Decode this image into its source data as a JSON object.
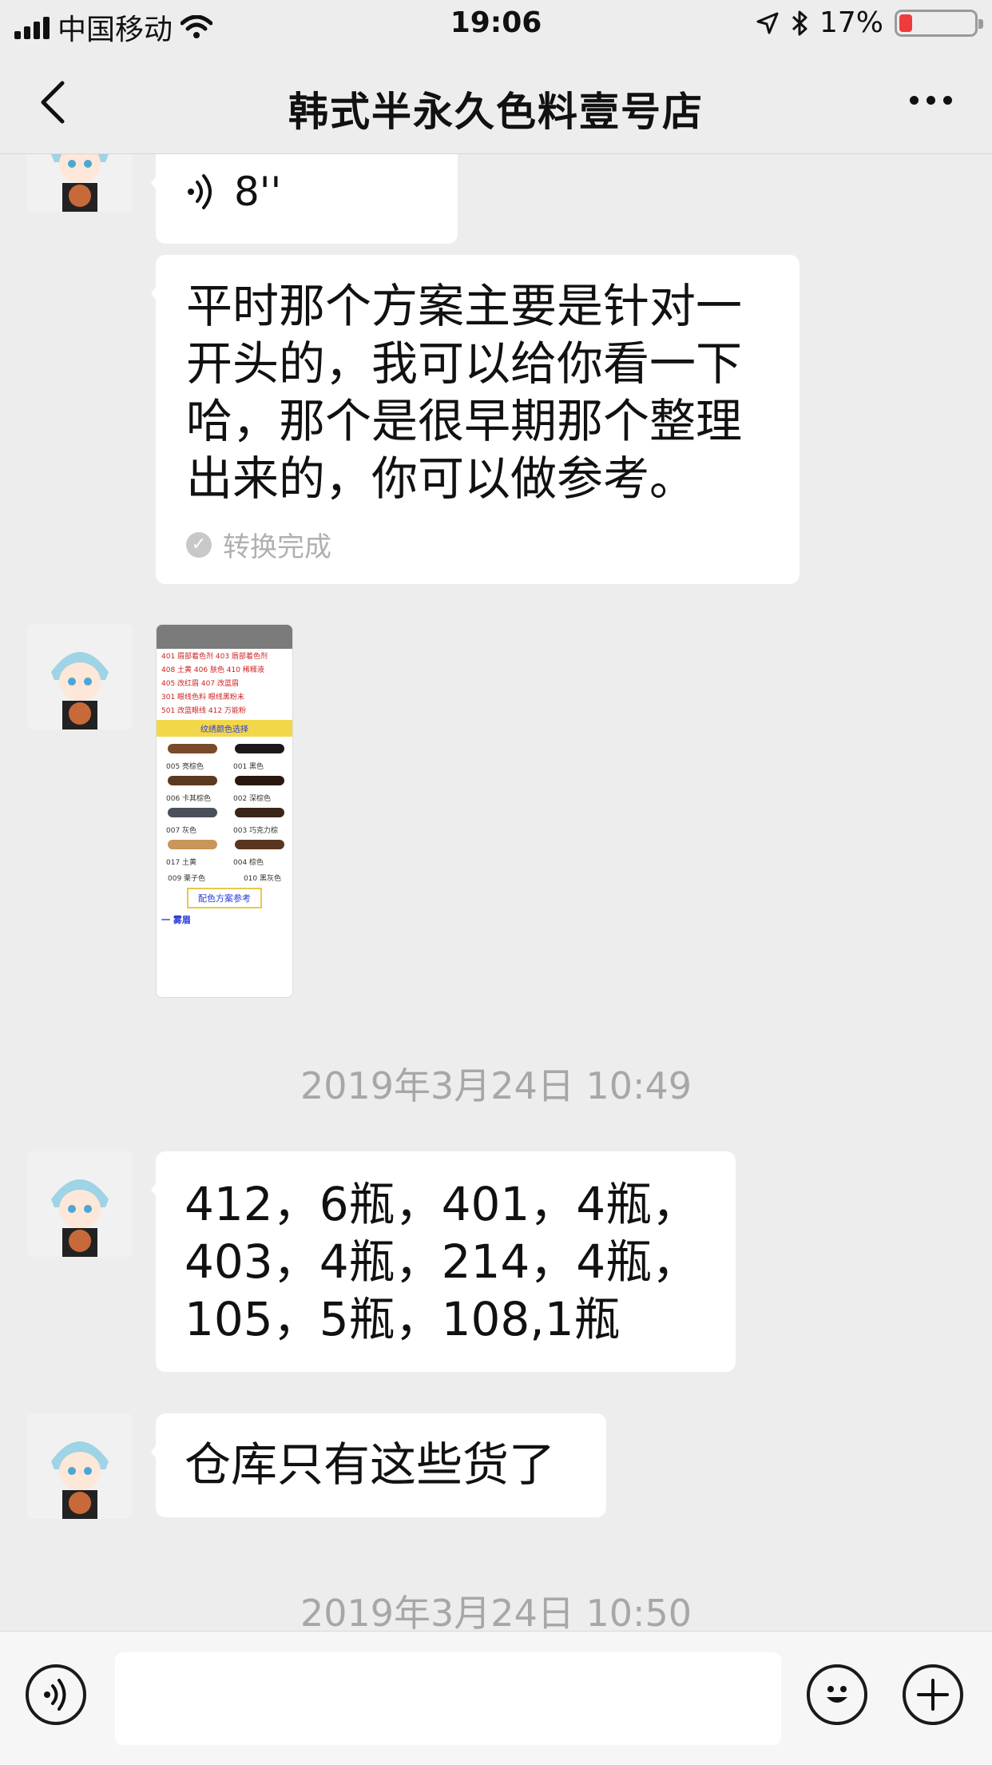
{
  "status_bar": {
    "carrier": "中国移动",
    "time": "19:06",
    "battery_percent": "17%",
    "battery_level": 0.17
  },
  "nav": {
    "title": "韩式半永久色料壹号店",
    "back_icon": "chevron-left-icon",
    "more_icon": "more-dots-icon"
  },
  "messages": [
    {
      "type": "voice",
      "duration": "8''"
    },
    {
      "type": "text",
      "text": "平时那个方案主要是针对一\n开头的，我可以给你看一下\n哈，那个是很早期那个整理\n出来的，你可以做参考。",
      "conversion_status": "转换完成"
    },
    {
      "type": "image"
    },
    {
      "type": "timestamp",
      "text": "2019年3月24日 10:49"
    },
    {
      "type": "text",
      "text": "412，6瓶，401，4瓶，\n403，4瓶，214，4瓶，\n105，5瓶，108,1瓶"
    },
    {
      "type": "text",
      "text": "仓库只有这些货了"
    },
    {
      "type": "timestamp",
      "text": "2019年3月24日 10:50"
    }
  ],
  "image_card": {
    "header": "",
    "rows": [
      "401 眉部着色剂 403 唇部着色剂",
      "408 土黄 406 肤色 410 稀释液",
      "405 改红眉 407 改蓝眉",
      "301 眼线色料 眼线黑粉末",
      "501 改蓝眼线 412 万能粉"
    ],
    "band": "纹绣颜色选择",
    "swatches": [
      {
        "label": "005 亮棕色",
        "color": "#7a4a2a"
      },
      {
        "label": "001 黑色",
        "color": "#1a1a1a"
      },
      {
        "label": "006 卡其棕色",
        "color": "#5b3a22"
      },
      {
        "label": "002 深棕色",
        "color": "#2a1810"
      },
      {
        "label": "007 灰色",
        "color": "#4a4f5a"
      },
      {
        "label": "003 巧克力棕",
        "color": "#3b2418"
      },
      {
        "label": "017 土黄",
        "color": "#c8955a"
      },
      {
        "label": "004 棕色",
        "color": "#5a3520"
      }
    ],
    "footer_labels": [
      "009 栗子色",
      "010 黑灰色"
    ],
    "button": "配色方案参考",
    "section": "一 雾眉"
  },
  "input_bar": {
    "voice_icon": "voice-input-icon",
    "emoji_icon": "emoji-icon",
    "plus_icon": "plus-icon",
    "placeholder": ""
  },
  "colors": {
    "background": "#ededed",
    "bubble": "#ffffff",
    "timestamp": "#a7a7a7",
    "battery_low": "#ef3b3b"
  }
}
